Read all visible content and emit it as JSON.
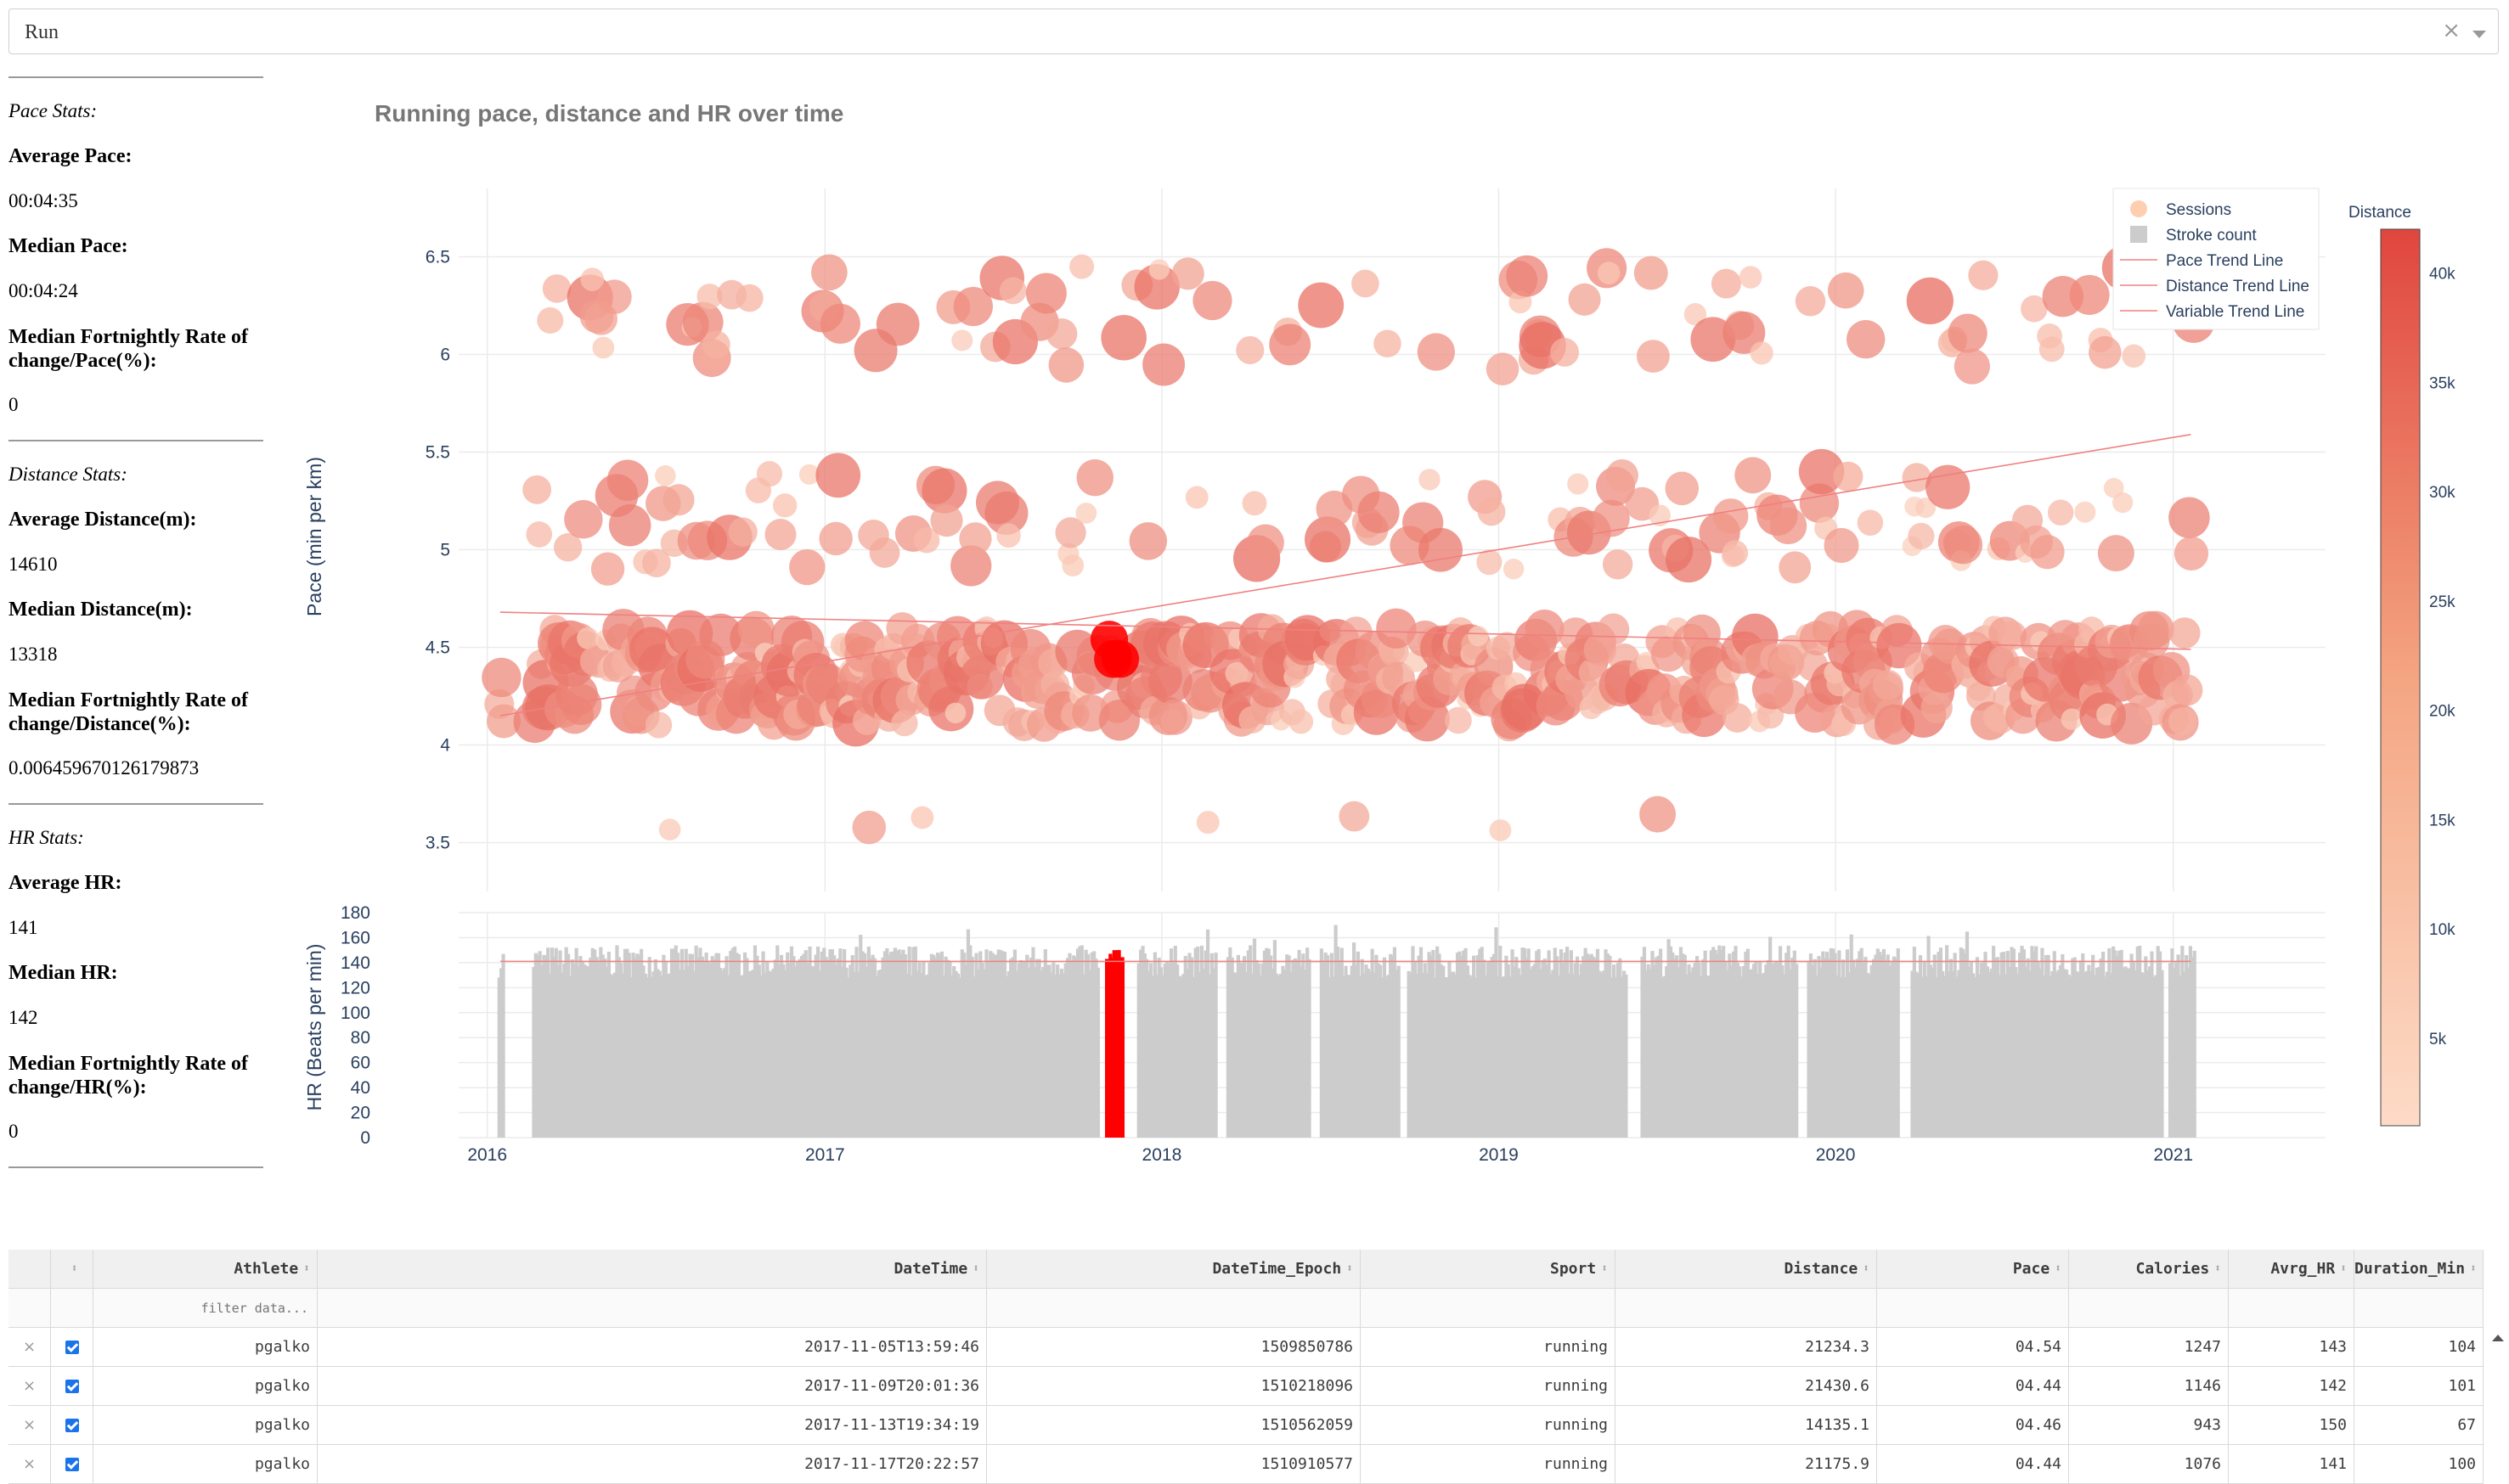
{
  "dropdown": {
    "value": "Run",
    "clear_icon": "×",
    "arrow_icon": "chevron-down-icon"
  },
  "stats": {
    "pace_title": "Pace Stats:",
    "avg_pace_label": "Average Pace:",
    "avg_pace": "00:04:35",
    "median_pace_label": "Median Pace:",
    "median_pace": "00:04:24",
    "pace_roc_label_1": "Median Fortnightly Rate of",
    "pace_roc_label_2": "change/Pace(%):",
    "pace_roc": "0",
    "distance_title": "Distance Stats:",
    "avg_dist_label": "Average Distance(m):",
    "avg_dist": "14610",
    "median_dist_label": "Median Distance(m):",
    "median_dist": "13318",
    "dist_roc_label_1": "Median Fortnightly Rate of",
    "dist_roc_label_2": "change/Distance(%):",
    "dist_roc": "0.006459670126179873",
    "hr_title": "HR Stats:",
    "avg_hr_label": "Average HR:",
    "avg_hr": "141",
    "median_hr_label": "Median HR:",
    "median_hr": "142",
    "hr_roc_label_1": "Median Fortnightly Rate of",
    "hr_roc_label_2": "change/HR(%):",
    "hr_roc": "0"
  },
  "chart_data": {
    "type": "scatter",
    "title": "Running pace, distance and HR over time",
    "top": {
      "ylabel": "Pace (min per km)",
      "ylim": [
        3.25,
        6.85
      ],
      "yticks": [
        3.5,
        4,
        4.5,
        5,
        5.5,
        6,
        6.5
      ],
      "ytick_labels": [
        "3.5",
        "4",
        "4.5",
        "5",
        "5.5",
        "6",
        "6.5"
      ]
    },
    "bottom": {
      "ylabel": "HR (Beats per min)",
      "ylim": [
        0,
        180
      ],
      "yticks": [
        0,
        20,
        40,
        60,
        80,
        100,
        120,
        140,
        160,
        180
      ],
      "ytick_labels": [
        "0",
        "20",
        "40",
        "60",
        "80",
        "100",
        "120",
        "140",
        "160",
        "180"
      ],
      "hr_reference": 141
    },
    "x": {
      "range": [
        "2015-12-01",
        "2021-06-15"
      ],
      "ticks": [
        "2016-01-01",
        "2017-01-01",
        "2018-01-01",
        "2019-01-01",
        "2020-01-01",
        "2021-01-01"
      ],
      "tick_labels": [
        "2016",
        "2017",
        "2018",
        "2019",
        "2020",
        "2021"
      ]
    },
    "legend": {
      "position": "top-right",
      "items": [
        "Sessions",
        "Stroke count",
        "Pace Trend Line",
        "Distance Trend Line",
        "Variable Trend Line"
      ]
    },
    "colorbar": {
      "title": "Distance",
      "range": [
        1000,
        42000
      ],
      "ticks": [
        5000,
        10000,
        15000,
        20000,
        25000,
        30000,
        35000,
        40000
      ],
      "tick_labels": [
        "5k",
        "10k",
        "15k",
        "20k",
        "25k",
        "30k",
        "35k",
        "40k"
      ]
    },
    "trend_lines": [
      {
        "name": "Pace Trend Line",
        "x": [
          "2016-01-15",
          "2021-01-20"
        ],
        "y": [
          4.68,
          4.49
        ]
      },
      {
        "name": "Distance Trend Line",
        "x": [
          "2016-01-15",
          "2021-01-20"
        ],
        "y": [
          4.15,
          5.59
        ]
      }
    ],
    "selected_range": [
      "2017-11-05",
      "2017-11-20"
    ],
    "highlight_points": [
      {
        "date": "2017-11-05",
        "pace": 4.54,
        "distance": 21234.3,
        "hr": 143
      },
      {
        "date": "2017-11-09",
        "pace": 4.44,
        "distance": 21430.6,
        "hr": 142
      },
      {
        "date": "2017-11-13",
        "pace": 4.46,
        "distance": 14135.1,
        "hr": 150
      },
      {
        "date": "2017-11-17",
        "pace": 4.44,
        "distance": 21175.9,
        "hr": 141
      }
    ],
    "colors": {
      "low": "#fddbc7",
      "high": "#e0463e",
      "selected": "#ff0000",
      "bar": "#cccccc",
      "trend": "#f08080"
    }
  },
  "table": {
    "columns": [
      "",
      "",
      "Athlete",
      "DateTime",
      "DateTime_Epoch",
      "Sport",
      "Distance",
      "Pace",
      "Calories",
      "Avrg_HR",
      "Duration_Min"
    ],
    "filter_placeholder": "filter data...",
    "rows": [
      [
        "pgalko",
        "2017-11-05T13:59:46",
        "1509850786",
        "running",
        "21234.3",
        "04.54",
        "1247",
        "143",
        "104"
      ],
      [
        "pgalko",
        "2017-11-09T20:01:36",
        "1510218096",
        "running",
        "21430.6",
        "04.44",
        "1146",
        "142",
        "101"
      ],
      [
        "pgalko",
        "2017-11-13T19:34:19",
        "1510562059",
        "running",
        "14135.1",
        "04.46",
        "943",
        "150",
        "67"
      ],
      [
        "pgalko",
        "2017-11-17T20:22:57",
        "1510910577",
        "running",
        "21175.9",
        "04.44",
        "1076",
        "141",
        "100"
      ]
    ]
  }
}
